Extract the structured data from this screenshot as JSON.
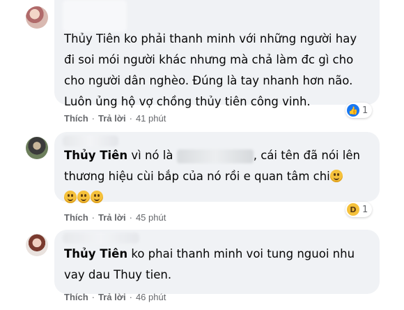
{
  "comments": [
    {
      "author": "",
      "lines": [
        "Thủy Tiên ko phải thanh minh với những người hay",
        "đi soi mói người khác nhưng mà chả làm đc gì cho",
        "cho người dân nghèo. Đúng là tay nhanh hơn não.",
        "Luôn ủng hộ vợ chồng thủy tiên công vinh."
      ],
      "like_label": "Thích",
      "reply_label": "Trả lời",
      "time": "41 phút",
      "reaction": "like-icon",
      "reaction_count": "1"
    },
    {
      "author": "Thủy Tiên",
      "line1_before": "vì nó là",
      "line1_after": ", cái tên đã nói lên",
      "line2": "thương hiệu cùi bắp của nó rồi e quan tâm chi",
      "like_label": "Thích",
      "reply_label": "Trả lời",
      "time": "45 phút",
      "reaction": "haha-icon",
      "reaction_count": "1"
    },
    {
      "author": "Thủy Tiên",
      "line1": "ko phai thanh minh voi tung nguoi nhu",
      "line2": "vay dau Thuy tien.",
      "like_label": "Thích",
      "reply_label": "Trả lời",
      "time": "46 phút"
    }
  ],
  "colors": {
    "bubble": "#f0f2f5",
    "meta": "#65676b",
    "like": "#1877f2"
  }
}
